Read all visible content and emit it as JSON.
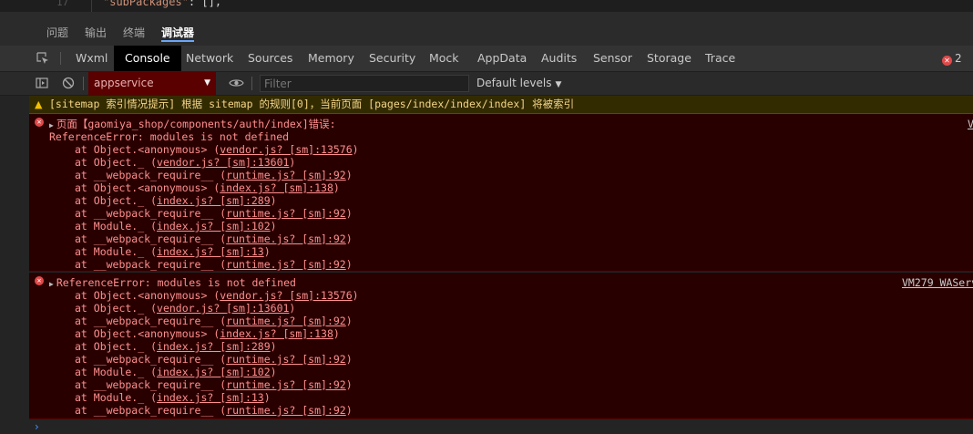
{
  "editor": {
    "line_number": "17",
    "code_key": "\"subPackages\"",
    "code_rest": ": [],"
  },
  "panel_tabs": [
    "问题",
    "输出",
    "终端",
    "调试器"
  ],
  "devtools": {
    "tabs": [
      "Wxml",
      "Console",
      "Network",
      "Sources",
      "Memory",
      "Security",
      "Mock",
      "AppData",
      "Audits",
      "Sensor",
      "Storage",
      "Trace"
    ],
    "active_tab": "Console",
    "error_count": "2"
  },
  "toolbar": {
    "context": "appservice",
    "filter_placeholder": "Filter",
    "levels": "Default levels"
  },
  "warning": {
    "text": "[sitemap 索引情况提示] 根据 sitemap 的规则[0]，当前页面 [pages/index/index/index] 将被索引"
  },
  "errors": [
    {
      "header": "页面【gaomiya_shop/components/auth/index]错误:",
      "message": "ReferenceError: modules is not defined",
      "source": "V",
      "frames": [
        {
          "fn": "at Object.<anonymous>",
          "loc": "vendor.js? [sm]:13576"
        },
        {
          "fn": "at Object._",
          "loc": "vendor.js? [sm]:13601"
        },
        {
          "fn": "at __webpack_require__",
          "loc": "runtime.js? [sm]:92"
        },
        {
          "fn": "at Object.<anonymous>",
          "loc": "index.js? [sm]:138"
        },
        {
          "fn": "at Object._",
          "loc": "index.js? [sm]:289"
        },
        {
          "fn": "at __webpack_require__",
          "loc": "runtime.js? [sm]:92"
        },
        {
          "fn": "at Module._",
          "loc": "index.js? [sm]:102"
        },
        {
          "fn": "at __webpack_require__",
          "loc": "runtime.js? [sm]:92"
        },
        {
          "fn": "at Module._",
          "loc": "index.js? [sm]:13"
        },
        {
          "fn": "at __webpack_require__",
          "loc": "runtime.js? [sm]:92"
        }
      ]
    },
    {
      "header": "ReferenceError: modules is not defined",
      "source": "VM279 WAServ",
      "frames": [
        {
          "fn": "at Object.<anonymous>",
          "loc": "vendor.js? [sm]:13576"
        },
        {
          "fn": "at Object._",
          "loc": "vendor.js? [sm]:13601"
        },
        {
          "fn": "at __webpack_require__",
          "loc": "runtime.js? [sm]:92"
        },
        {
          "fn": "at Object.<anonymous>",
          "loc": "index.js? [sm]:138"
        },
        {
          "fn": "at Object._",
          "loc": "index.js? [sm]:289"
        },
        {
          "fn": "at __webpack_require__",
          "loc": "runtime.js? [sm]:92"
        },
        {
          "fn": "at Module._",
          "loc": "index.js? [sm]:102"
        },
        {
          "fn": "at __webpack_require__",
          "loc": "runtime.js? [sm]:92"
        },
        {
          "fn": "at Module._",
          "loc": "index.js? [sm]:13"
        },
        {
          "fn": "at __webpack_require__",
          "loc": "runtime.js? [sm]:92"
        }
      ]
    }
  ],
  "colors": {
    "error_bg": "#290000",
    "error_text": "#ff8f8f",
    "warning_bg": "#332b00",
    "warning_text": "#f4d58a",
    "active_tab_bg": "#000000",
    "context_bg": "#5a0000"
  }
}
